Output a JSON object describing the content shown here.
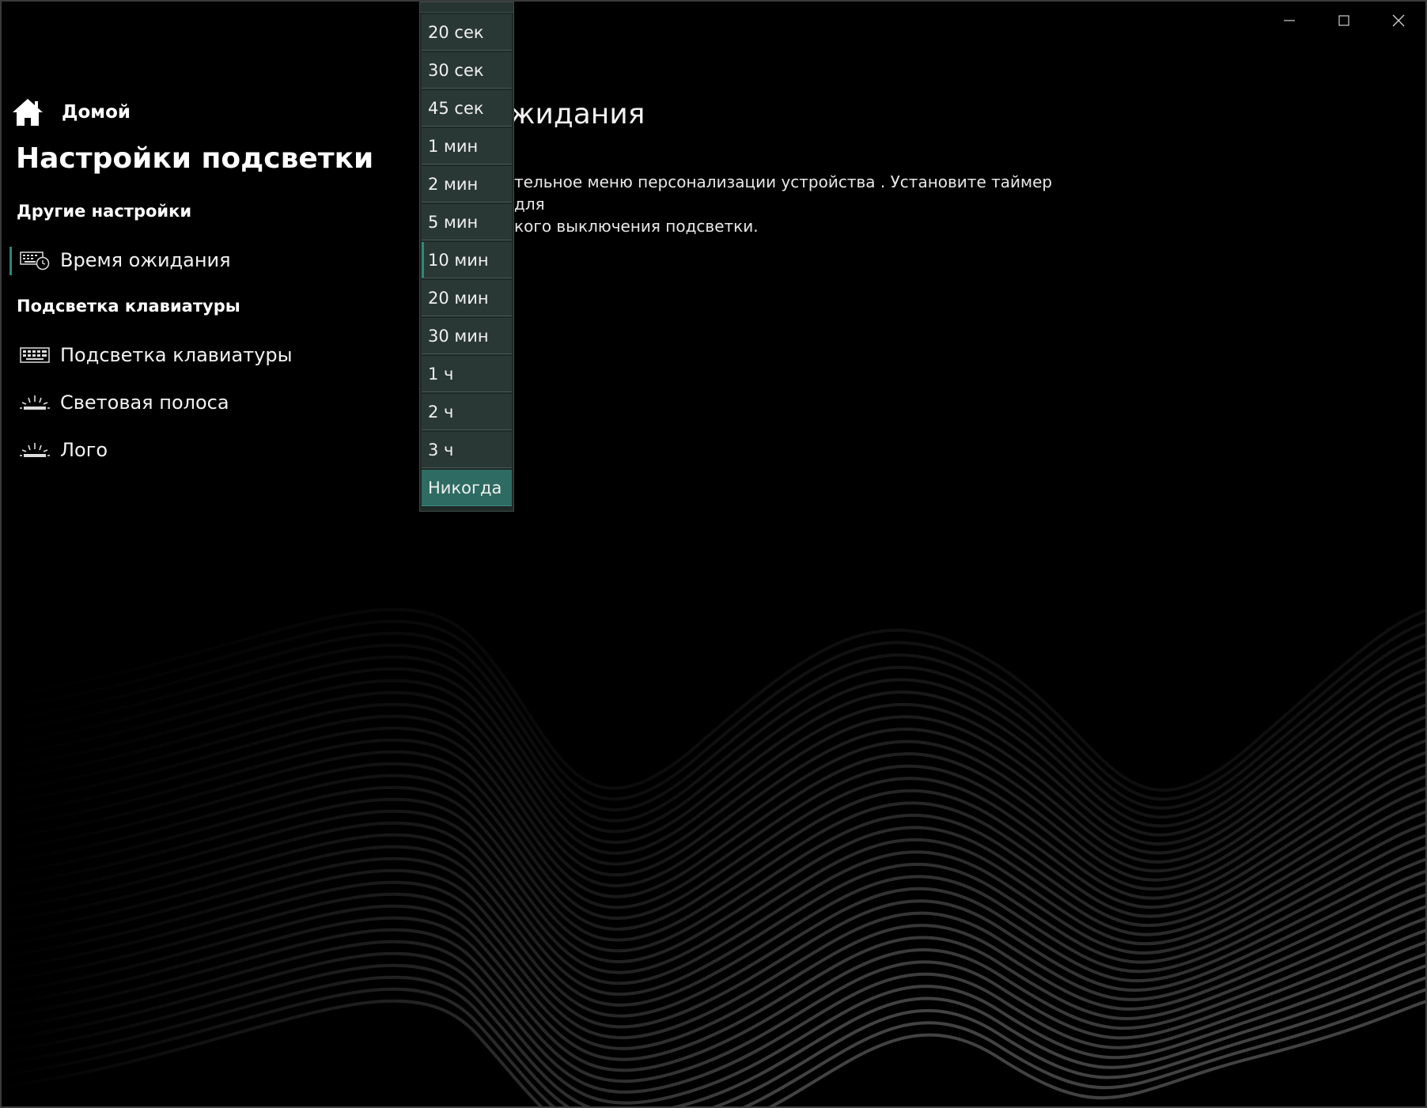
{
  "window": {
    "controls": [
      "minimize",
      "maximize",
      "close"
    ]
  },
  "sidebar": {
    "home_label": "Домой",
    "page_title": "Настройки подсветки",
    "sections": [
      {
        "title": "Другие настройки",
        "items": [
          {
            "label": "Время ожидания",
            "icon": "keyboard-timer-icon",
            "selected": true
          }
        ]
      },
      {
        "title": "Подсветка клавиатуры",
        "items": [
          {
            "label": "Подсветка клавиатуры",
            "icon": "keyboard-icon"
          },
          {
            "label": "Световая полоса",
            "icon": "lightbar-icon"
          },
          {
            "label": "Лого",
            "icon": "logo-light-icon"
          }
        ]
      }
    ]
  },
  "content": {
    "title_visible": "ожидания",
    "description_line1": "тельное меню персонализации устройства . Установите таймер для",
    "description_line2": "кого выключения подсветки."
  },
  "dropdown": {
    "options": [
      "20 сек",
      "30 сек",
      "45 сек",
      "1 мин",
      "2 мин",
      "5 мин",
      "10 мин",
      "20 мин",
      "30 мин",
      "1 ч",
      "2 ч",
      "3 ч",
      "Никогда"
    ],
    "current": "10 мин",
    "highlighted": "Никогда"
  },
  "colors": {
    "background": "#000000",
    "accent": "#2a8a78",
    "dropdown_bg": "#2a3835",
    "dropdown_highlight": "#2e6b62"
  }
}
